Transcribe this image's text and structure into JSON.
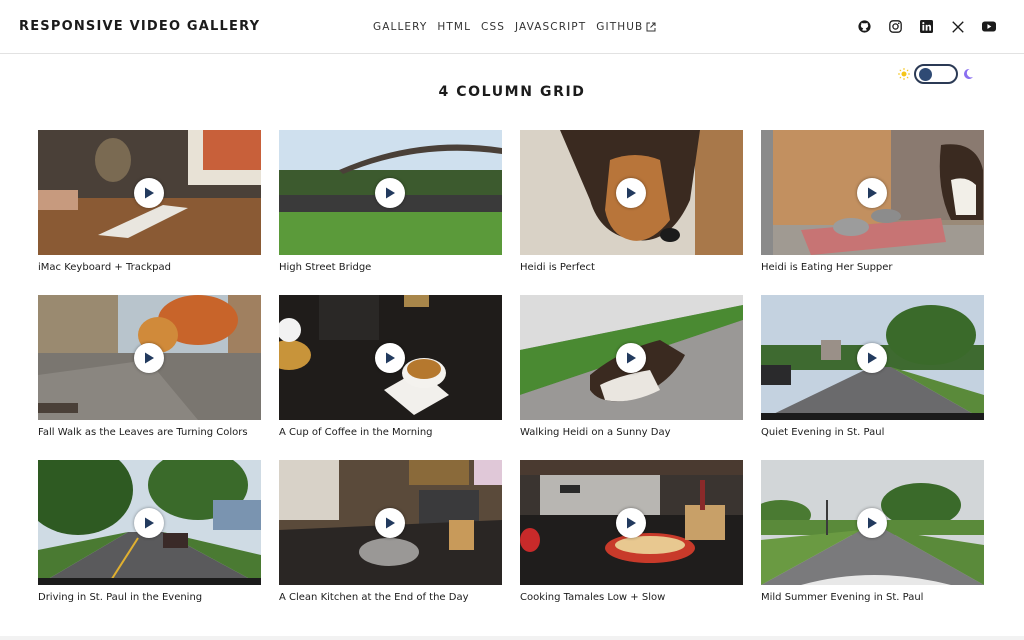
{
  "header": {
    "title": "RESPONSIVE VIDEO GALLERY",
    "nav": [
      {
        "label": "GALLERY"
      },
      {
        "label": "HTML"
      },
      {
        "label": "CSS"
      },
      {
        "label": "JAVASCRIPT"
      },
      {
        "label": "GITHUB"
      }
    ],
    "social_icons": [
      "github-icon",
      "instagram-icon",
      "linkedin-icon",
      "x-icon",
      "youtube-icon"
    ]
  },
  "theme_toggle": {
    "state": "dark",
    "sun_icon": "sun-icon",
    "moon_icon": "moon-icon"
  },
  "main": {
    "heading": "4 COLUMN GRID",
    "videos": [
      {
        "caption": "iMac Keyboard + Trackpad"
      },
      {
        "caption": "High Street Bridge"
      },
      {
        "caption": "Heidi is Perfect"
      },
      {
        "caption": "Heidi is Eating Her Supper"
      },
      {
        "caption": "Fall Walk as the Leaves are Turning Colors"
      },
      {
        "caption": "A Cup of Coffee in the Morning"
      },
      {
        "caption": "Walking Heidi on a Sunny Day"
      },
      {
        "caption": "Quiet Evening in St. Paul"
      },
      {
        "caption": "Driving in St. Paul in the Evening"
      },
      {
        "caption": "A Clean Kitchen at the End of the Day"
      },
      {
        "caption": "Cooking Tamales Low + Slow"
      },
      {
        "caption": "Mild Summer Evening in St. Paul"
      }
    ]
  },
  "colors": {
    "accent": "#2f4a74",
    "sun": "#f5c518",
    "moon": "#8a6ff0"
  }
}
